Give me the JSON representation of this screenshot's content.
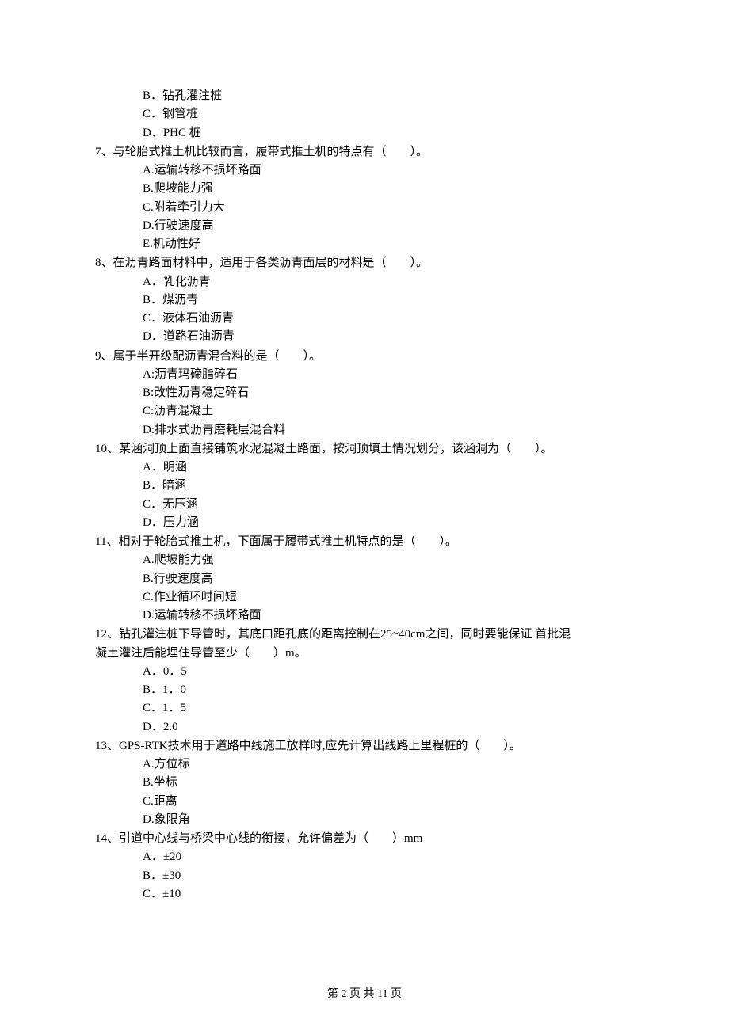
{
  "orphan_options": [
    "B．钻孔灌注桩",
    "C．钢管桩",
    "D．PHC 桩"
  ],
  "questions": [
    {
      "num": "7、",
      "stem": "与轮胎式推土机比较而言，履带式推土机的特点有（　　）。",
      "opts": [
        "A.运输转移不损坏路面",
        "B.爬坡能力强",
        "C.附着牵引力大",
        "D.行驶速度高",
        "E.机动性好"
      ]
    },
    {
      "num": "8、",
      "stem": "在沥青路面材料中，适用于各类沥青面层的材料是（　　）。",
      "opts": [
        "A．乳化沥青",
        "B．煤沥青",
        "C．液体石油沥青",
        "D．道路石油沥青"
      ]
    },
    {
      "num": "9、",
      "stem": "属于半开级配沥青混合料的是（　　）。",
      "opts": [
        "A:沥青玛碲脂碎石",
        "B:改性沥青稳定碎石",
        "C:沥青混凝土",
        "D:排水式沥青磨耗层混合料"
      ]
    },
    {
      "num": "10、",
      "stem": "某涵洞顶上面直接铺筑水泥混凝土路面，按洞顶填土情况划分，该涵洞为（　　）。",
      "opts": [
        "A．明涵",
        "B．暗涵",
        "C．无压涵",
        "D．压力涵"
      ]
    },
    {
      "num": "11、",
      "stem": "相对于轮胎式推土机，下面属于履带式推土机特点的是（　　）。",
      "opts": [
        "A.爬坡能力强",
        "B.行驶速度高",
        "C.作业循环时间短",
        "D.运输转移不损坏路面"
      ]
    },
    {
      "num": "12、",
      "stem": "钻孔灌注桩下导管时，其底口距孔底的距离控制在25~40cm之间，同时要能保证 首批混",
      "stem2": "凝土灌注后能埋住导管至少（　　）m。",
      "opts": [
        "A．0．5",
        "B．1．0",
        "C．1．5",
        "D．2.0"
      ]
    },
    {
      "num": "13、",
      "stem": "GPS-RTK技术用于道路中线施工放样时,应先计算出线路上里程桩的（　　）。",
      "opts": [
        "A.方位标",
        "B.坐标",
        "C.距离",
        "D.象限角"
      ]
    },
    {
      "num": "14、",
      "stem": "引道中心线与桥梁中心线的衔接，允许偏差为（　　）mm",
      "opts": [
        "A．±20",
        "B．±30",
        "C．±10"
      ]
    }
  ],
  "footer": "第 2 页 共 11 页"
}
